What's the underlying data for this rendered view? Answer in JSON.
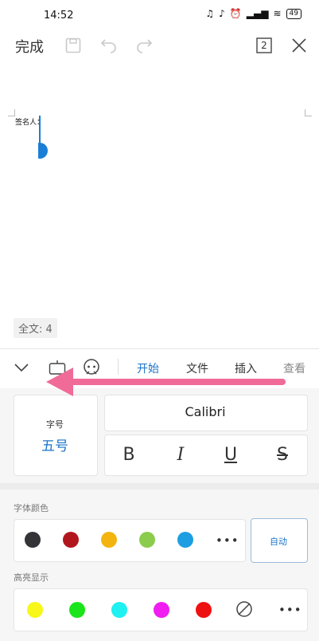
{
  "status": {
    "time": "14:52",
    "battery": "49"
  },
  "toolbar": {
    "done_label": "完成",
    "page_count": "2"
  },
  "document": {
    "signature_label": "签名人：",
    "word_count": "全文: 4"
  },
  "ribbon": {
    "tabs": [
      "开始",
      "文件",
      "插入",
      "查看"
    ]
  },
  "font": {
    "size_label": "字号",
    "size_value": "五号",
    "family": "Calibri",
    "styles": [
      "B",
      "I",
      "U",
      "S"
    ]
  },
  "font_color": {
    "label": "字体颜色",
    "auto_label": "自动",
    "colors": [
      "#333338",
      "#b2161d",
      "#f3b40f",
      "#8bcc4c",
      "#1e9ee2"
    ]
  },
  "highlight": {
    "label": "高亮显示",
    "colors": [
      "#f7f71a",
      "#19e51a",
      "#1ff0f0",
      "#f01cf0",
      "#ee1111"
    ]
  },
  "accent": "#1a74c9",
  "annotation_color": "#f06b97"
}
